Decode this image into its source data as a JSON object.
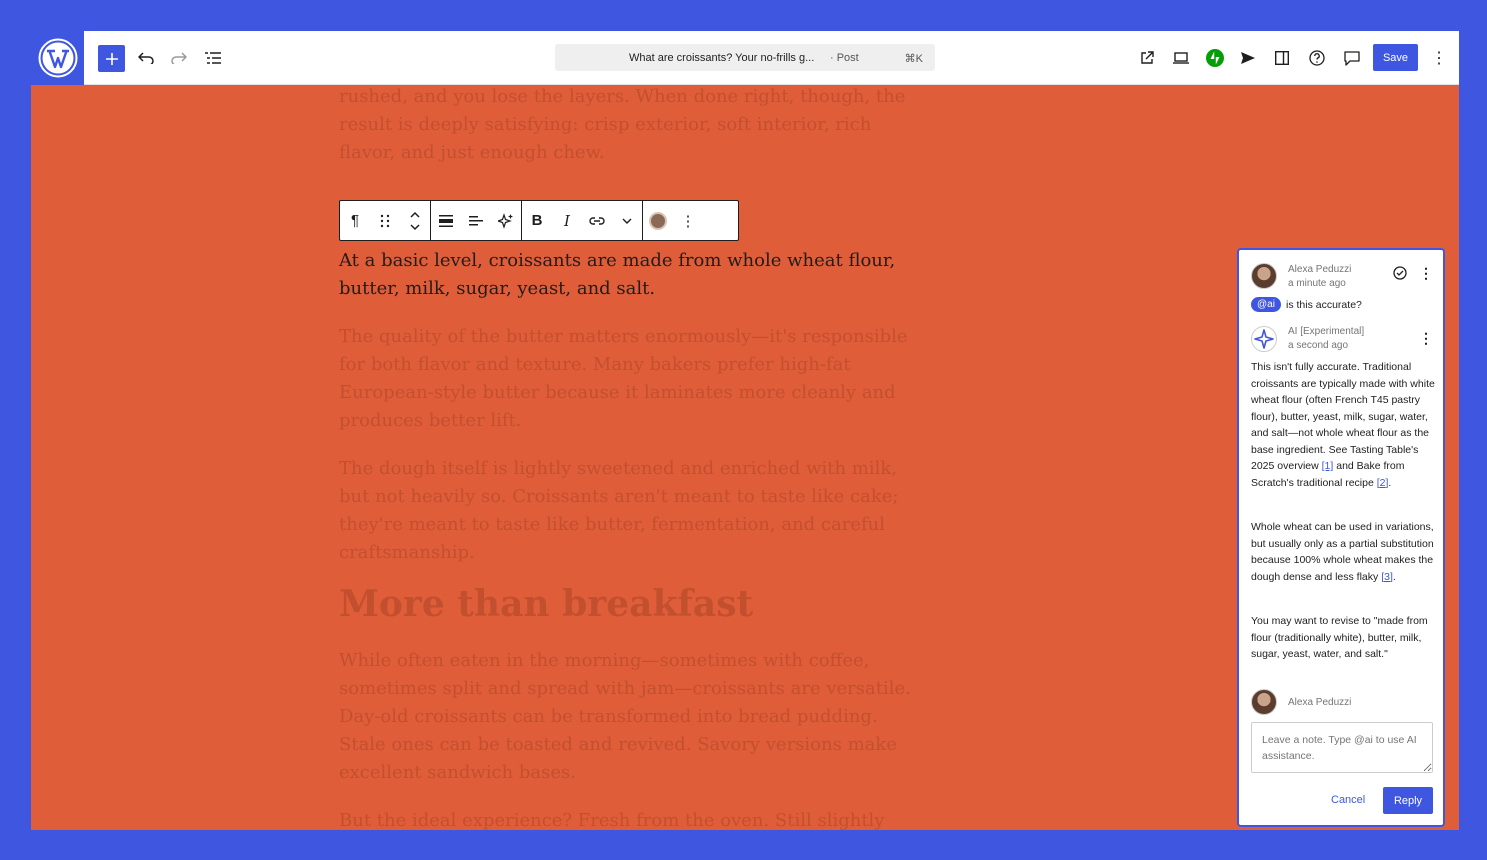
{
  "header": {
    "document_title": "What are croissants? Your no-frills g...",
    "post_type": "· Post",
    "shortcut": "⌘K",
    "save_label": "Save"
  },
  "content": {
    "paragraph_top": "rushed, and you lose the layers. When done right, though, the result is deeply satisfying: crisp exterior, soft interior, rich flavor, and just enough chew.",
    "active_paragraph": "At a basic level, croissants are made from whole wheat flour, butter, milk, sugar, yeast, and salt.",
    "paragraph_butter": "The quality of the butter matters enormously—it's responsible for both flavor and texture. Many bakers prefer high-fat European-style butter because it laminates more cleanly and produces better lift.",
    "paragraph_dough": "The dough itself is lightly sweetened and enriched with milk, but not heavily so. Croissants aren't meant to taste like cake; they're meant to taste like butter, fermentation, and careful craftsmanship.",
    "heading_breakfast": "More than breakfast",
    "paragraph_morning": "While often eaten in the morning—sometimes with coffee, sometimes split and spread with jam—croissants are versatile. Day-old croissants can be transformed into bread pudding. Stale ones can be toasted and revived. Savory versions make excellent sandwich bases.",
    "paragraph_ideal": "But the ideal experience? Fresh from the oven. Still slightly"
  },
  "comments": {
    "first": {
      "author": "Alexa Peduzzi",
      "time": "a minute ago",
      "tag": "@ai",
      "text": "is this accurate?"
    },
    "ai": {
      "author": "AI [Experimental]",
      "time": "a second ago",
      "p1_a": "This isn't fully accurate. Traditional croissants are typically made with white wheat flour (often French T45 pastry flour), butter, yeast, milk, sugar, water, and salt—not whole wheat flour as the base ingredient. See Tasting Table's 2025 overview ",
      "ref1": "[1]",
      "p1_b": " and Bake from Scratch's traditional recipe ",
      "ref2": "[2]",
      "p1_c": ".",
      "p2_a": "Whole wheat can be used in variations, but usually only as a partial substitution because 100% whole wheat makes the dough dense and less flaky ",
      "ref3": "[3]",
      "p2_b": ".",
      "p3": "You may want to revise to \"made from flour (traditionally white), butter, milk, sugar, yeast, water, and salt.\""
    },
    "reply": {
      "author": "Alexa Peduzzi",
      "placeholder": "Leave a note. Type @ai to use AI assistance.",
      "cancel_label": "Cancel",
      "reply_label": "Reply"
    }
  },
  "colors": {
    "accent": "#3f57e0",
    "canvas": "#df5d39"
  }
}
